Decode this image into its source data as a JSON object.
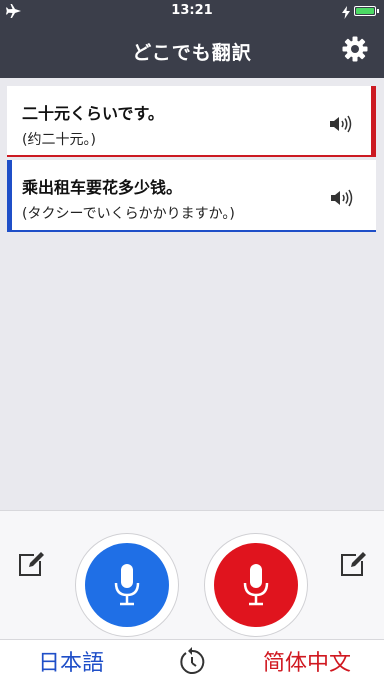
{
  "status_bar": {
    "time": "13:21",
    "battery_percent": 100,
    "icons": [
      "airplane-icon",
      "charging-icon",
      "battery-icon"
    ]
  },
  "header": {
    "title": "どこでも翻訳",
    "settings_icon": "gear-icon"
  },
  "translations": [
    {
      "main": "二十元くらいです。",
      "sub": "(约二十元。)",
      "accent": "#cc1a22",
      "icon": "speaker-icon"
    },
    {
      "main": "乘出租车要花多少钱。",
      "sub": "(タクシーでいくらかかりますか。)",
      "accent": "#1f4fc8",
      "icon": "speaker-icon"
    }
  ],
  "controls": {
    "source_language": "日本語",
    "target_language": "简体中文",
    "source_mic_color": "#1f6fe6",
    "target_mic_color": "#e0141e",
    "icons": [
      "edit-icon",
      "microphone-icon",
      "history-icon"
    ]
  }
}
